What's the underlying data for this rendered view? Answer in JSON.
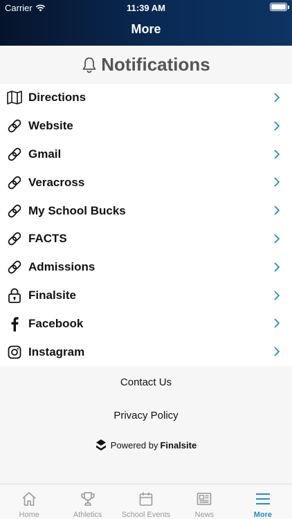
{
  "status_bar": {
    "carrier": "Carrier",
    "time": "11:39 AM"
  },
  "nav": {
    "title": "More"
  },
  "notifications": {
    "label": "Notifications",
    "icon": "bell-icon"
  },
  "menu": {
    "items": [
      {
        "label": "Directions",
        "icon": "map-icon"
      },
      {
        "label": "Website",
        "icon": "link-icon"
      },
      {
        "label": "Gmail",
        "icon": "link-icon"
      },
      {
        "label": "Veracross",
        "icon": "link-icon"
      },
      {
        "label": "My School Bucks",
        "icon": "link-icon"
      },
      {
        "label": "FACTS",
        "icon": "link-icon"
      },
      {
        "label": "Admissions",
        "icon": "link-icon"
      },
      {
        "label": "Finalsite",
        "icon": "lock-icon"
      },
      {
        "label": "Facebook",
        "icon": "facebook-icon"
      },
      {
        "label": "Instagram",
        "icon": "instagram-icon"
      }
    ]
  },
  "footer": {
    "contact": "Contact Us",
    "privacy": "Privacy Policy",
    "powered_prefix": "Powered by",
    "powered_brand": "Finalsite"
  },
  "tabbar": {
    "tabs": [
      {
        "label": "Home",
        "icon": "home-icon"
      },
      {
        "label": "Athletics",
        "icon": "trophy-icon"
      },
      {
        "label": "School Events",
        "icon": "calendar-icon"
      },
      {
        "label": "News",
        "icon": "newspaper-icon"
      },
      {
        "label": "More",
        "icon": "menu-icon"
      }
    ],
    "active": "More"
  },
  "colors": {
    "accent": "#1f8cc9",
    "header_dark": "#06142a",
    "header_light": "#0d3463"
  }
}
